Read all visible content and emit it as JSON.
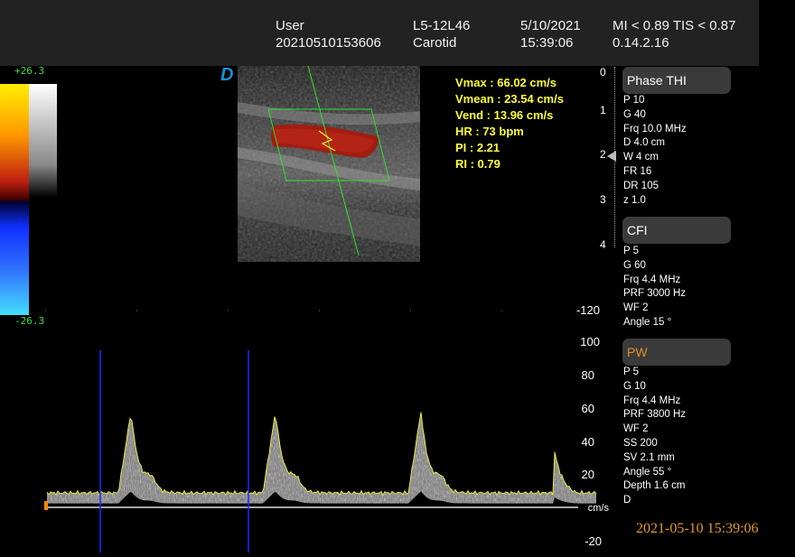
{
  "header": {
    "user_label": "User",
    "exam_id": "20210510153606",
    "probe": "L5-12L46",
    "preset": "Carotid",
    "date": "5/10/2021",
    "time": "15:39:06",
    "indices": "MI < 0.89  TIS < 0.87",
    "version": "0.14.2.16"
  },
  "colorbar": {
    "top_value": "+26.3",
    "bottom_value": "-26.3",
    "colors": {
      "top": "#ffee00",
      "mid_red": "#c02010",
      "mid_blue": "#1030ff",
      "bottom": "#44ddff"
    }
  },
  "bmode": {
    "logo": "D",
    "depth_marks": [
      "0",
      "1",
      "2",
      "3",
      "4"
    ]
  },
  "measurements": [
    "Vmax :  66.02 cm/s",
    "Vmean :  23.54 cm/s",
    "Vend :  13.96 cm/s",
    "HR :  73 bpm",
    "PI :  2.21",
    "RI :  0.79"
  ],
  "panels": {
    "thi": {
      "title": "Phase THI",
      "items": [
        "P 10",
        "G 40",
        "Frq 10.0 MHz",
        "D 4.0 cm",
        "W  4 cm",
        "FR 16",
        "DR 105",
        "z 1.0"
      ]
    },
    "cfi": {
      "title": "CFI",
      "items": [
        "P 5",
        "G 60",
        "Frq 4.4 MHz",
        "PRF 3000 Hz",
        "WF 2",
        "Angle 15 °"
      ]
    },
    "pw": {
      "title": "PW",
      "title_color": "#e0902a",
      "items": [
        "P 5",
        "G 10",
        "Frq 4.4 MHz",
        "PRF 3800 Hz",
        "WF 2",
        "SS 200",
        "SV 2.1 mm",
        "Angle 55 °",
        "Depth 1.6 cm",
        "D"
      ]
    }
  },
  "spectral": {
    "scale_labels": [
      "-120",
      "100",
      "80",
      "60",
      "40",
      "20",
      "cm/s",
      "-20"
    ],
    "trace_color": "#e8e840",
    "marker_color": "#1a2bff"
  },
  "footer": {
    "timestamp": "2021-05-10 15:39:06",
    "timestamp_color": "#e09a2a"
  }
}
